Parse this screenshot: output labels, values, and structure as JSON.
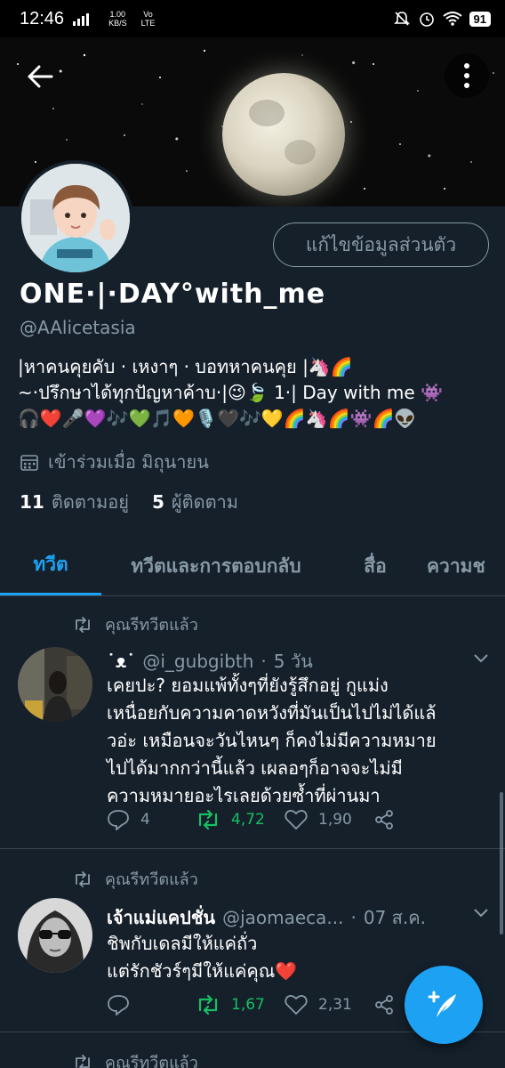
{
  "status_bar": {
    "time": "12:46",
    "net_speed": "1.00",
    "net_unit": "KB/S",
    "vo": "Vo",
    "lte": "LTE",
    "battery": "91"
  },
  "profile": {
    "edit_label": "แก้ไขข้อมูลส่วนตัว",
    "display_name": "ONE·|·DAY°with_me",
    "handle": "@AAlicetasia",
    "bio_lines": [
      "|หาคนคุยคับ · เหงาๆ · บอทหาคนคุย |🦄🌈",
      "~·ปรึกษาได้ทุกปัญหาค้าบ·|😉🍃 1·| Day with me 👾",
      "🎧❤️🎤💜🎶💚🎵🧡🎙️🖤🎶💛🌈🦄🌈👾🌈👽"
    ],
    "joined": "เข้าร่วมเมื่อ มิถุนายน",
    "following_count": "11",
    "following_label": "ติดตามอยู่",
    "followers_count": "5",
    "followers_label": "ผู้ติดตาม"
  },
  "tabs": [
    {
      "label": "ทวีต",
      "active": true
    },
    {
      "label": "ทวีตและการตอบกลับ",
      "active": false
    },
    {
      "label": "สื่อ",
      "active": false
    },
    {
      "label": "ความช",
      "active": false
    }
  ],
  "tweets": [
    {
      "retweet_label": "คุณรีทวีตแล้ว",
      "name": "˙ᴥ˙",
      "handle": "@i_gubgibth",
      "dot": "·",
      "time": "5 วัน",
      "text_lines": [
        "เคยปะ? ยอมแพ้ทั้งๆที่ยังรู้สึกอยู่ กูแม่ง",
        "เหนื่อยกับความคาดหวังที่มันเป็นไปไม่ได้แล้",
        "วอ่ะ เหมือนจะวันไหนๆ ก็คงไม่มีความหมาย",
        "ไปได้มากกว่านี้แล้ว เผลอๆก็อาจจะไม่มี",
        "ความหมายอะไรเลยด้วยซ้ำที่ผ่านมา"
      ],
      "replies": "4",
      "retweets": "4,72",
      "likes": "1,90"
    },
    {
      "retweet_label": "คุณรีทวีตแล้ว",
      "name": "เจ้าแม่แคปชั่น",
      "handle": "@jaomaeca...",
      "dot": "·",
      "time": "07 ส.ค.",
      "text_lines": [
        "ชิพกับเดลมีให้แค่ถั่ว",
        "แต่รักชัวร์ๆมีให้แค่คุณ❤️"
      ],
      "replies": "",
      "retweets": "1,67",
      "likes": "2,31"
    },
    {
      "retweet_label": "คุณรีทวีตแล้ว"
    }
  ],
  "colors": {
    "background": "#15202b",
    "accent": "#1da1f2",
    "secondary_text": "#8899a6",
    "retweet_green": "#17bf63"
  }
}
